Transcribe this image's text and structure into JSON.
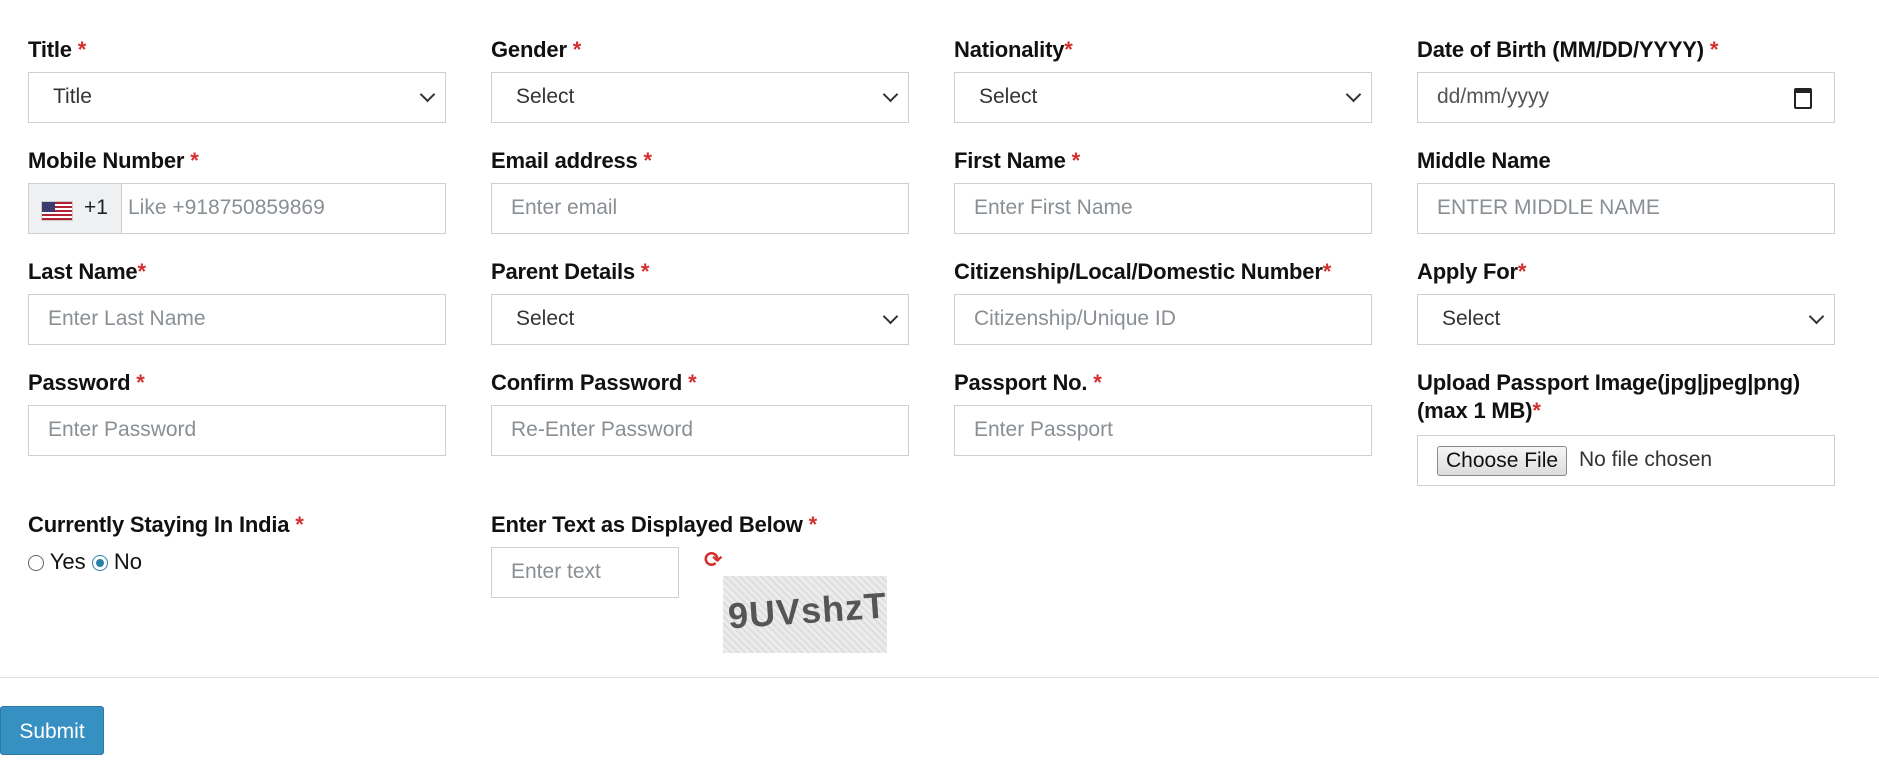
{
  "fields": {
    "title": {
      "label": "Title",
      "required": "*",
      "value": "Title"
    },
    "gender": {
      "label": "Gender",
      "required": "*",
      "value": "Select"
    },
    "nationality": {
      "label": "Nationality",
      "required": "*",
      "value": "Select"
    },
    "dob": {
      "label": "Date of Birth (MM/DD/YYYY)",
      "required": "*",
      "value": "dd/mm/yyyy"
    },
    "mobile": {
      "label": "Mobile Number",
      "required": "*",
      "dial_code": "+1",
      "country": "US",
      "placeholder": "Like +918750859869"
    },
    "email": {
      "label": "Email address",
      "required": "*",
      "placeholder": "Enter email"
    },
    "first_name": {
      "label": "First Name",
      "required": "*",
      "placeholder": "Enter First Name"
    },
    "middle_name": {
      "label": "Middle Name",
      "placeholder": "ENTER MIDDLE NAME"
    },
    "last_name": {
      "label": "Last Name",
      "required": "*",
      "placeholder": "Enter Last Name"
    },
    "parent_details": {
      "label": "Parent Details",
      "required": "*",
      "value": "Select"
    },
    "citizenship": {
      "label": "Citizenship/Local/Domestic Number",
      "required": "*",
      "placeholder": "Citizenship/Unique ID"
    },
    "apply_for": {
      "label": "Apply For",
      "required": "*",
      "value": "Select"
    },
    "password": {
      "label": "Password",
      "required": "*",
      "placeholder": "Enter Password"
    },
    "confirm_password": {
      "label": "Confirm Password",
      "required": "*",
      "placeholder": "Re-Enter Password"
    },
    "passport": {
      "label": "Passport No.",
      "required": "*",
      "placeholder": "Enter Passport"
    },
    "passport_image": {
      "label_line1": "Upload Passport Image(jpg|jpeg|png)",
      "label_line2": "(max 1 MB)",
      "required": "*",
      "button": "Choose File",
      "status": "No file chosen"
    },
    "staying_india": {
      "label": "Currently Staying In India",
      "required": "*",
      "options": [
        "Yes",
        "No"
      ],
      "selected": "No"
    },
    "captcha": {
      "label": "Enter Text as Displayed Below",
      "required": "*",
      "placeholder": "Enter text",
      "image_text": "9UVshzT"
    }
  },
  "submit_label": "Submit",
  "colors": {
    "required": "#d32f2f",
    "submit_bg": "#3790c2",
    "radio_selected": "#2a7fa8"
  },
  "icons": {
    "refresh": "refresh-icon",
    "calendar": "calendar-icon",
    "flag": "us-flag-icon",
    "dropdown": "chevron-down-icon"
  }
}
